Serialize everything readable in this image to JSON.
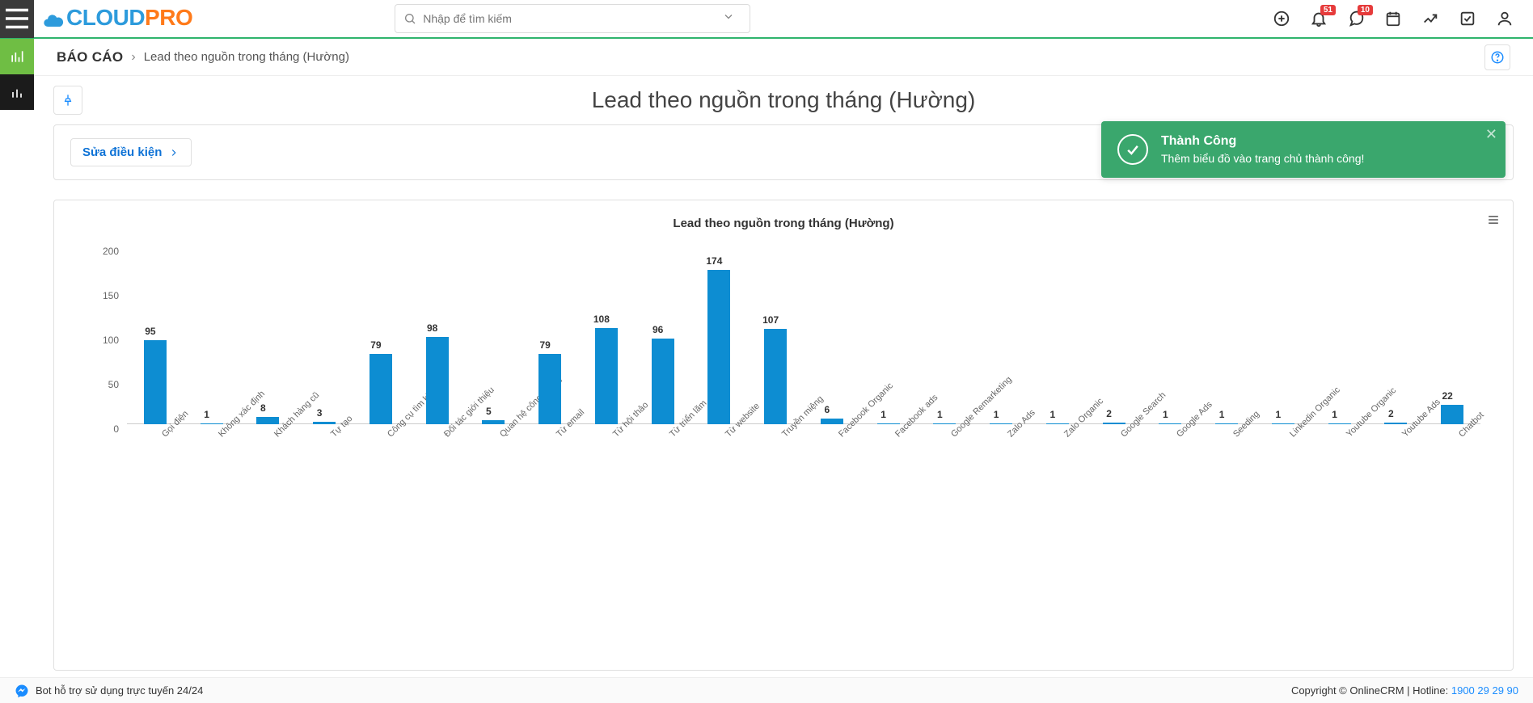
{
  "header": {
    "logo_text1": "CLOUD",
    "logo_text2": "PRO",
    "search_placeholder": "Nhập để tìm kiếm",
    "notif_badge": "51",
    "chat_badge": "10"
  },
  "breadcrumb": {
    "root": "BÁO CÁO",
    "item": "Lead theo nguồn trong tháng (Hường)"
  },
  "page": {
    "title": "Lead theo nguồn trong tháng (Hường)",
    "edit_conditions": "Sửa điều kiện"
  },
  "chart_data": {
    "type": "bar",
    "title": "Lead theo nguồn trong tháng (Hường)",
    "ylabel": "",
    "ylim": [
      0,
      200
    ],
    "yticks": [
      0,
      50,
      100,
      150,
      200
    ],
    "categories": [
      "Gọi điện",
      "Không xác định",
      "Khách hàng cũ",
      "Tự tạo",
      "Công cụ tìm kiếm",
      "Đối tác giới thiệu",
      "Quan hệ công chúng",
      "Từ email",
      "Từ hội thảo",
      "Từ triển lãm",
      "Từ website",
      "Truyền miệng",
      "Facebook Organic",
      "Facebook ads",
      "Google Remarketing",
      "Zalo Ads",
      "Zalo Organic",
      "Google Search",
      "Google Ads",
      "Seeding",
      "Linkedin Organic",
      "Youtube Organic",
      "Youtube Ads",
      "Chatbot"
    ],
    "values": [
      95,
      1,
      8,
      3,
      79,
      98,
      5,
      79,
      108,
      96,
      174,
      107,
      6,
      1,
      1,
      1,
      1,
      2,
      1,
      1,
      1,
      1,
      2,
      22
    ]
  },
  "toast": {
    "title": "Thành Công",
    "message": "Thêm biểu đồ vào trang chủ thành công!"
  },
  "footer": {
    "bot_text": "Bot hỗ trợ sử dụng trực tuyến 24/24",
    "copyright": "Copyright © OnlineCRM | Hotline: ",
    "hotline": "1900 29 29 90"
  }
}
